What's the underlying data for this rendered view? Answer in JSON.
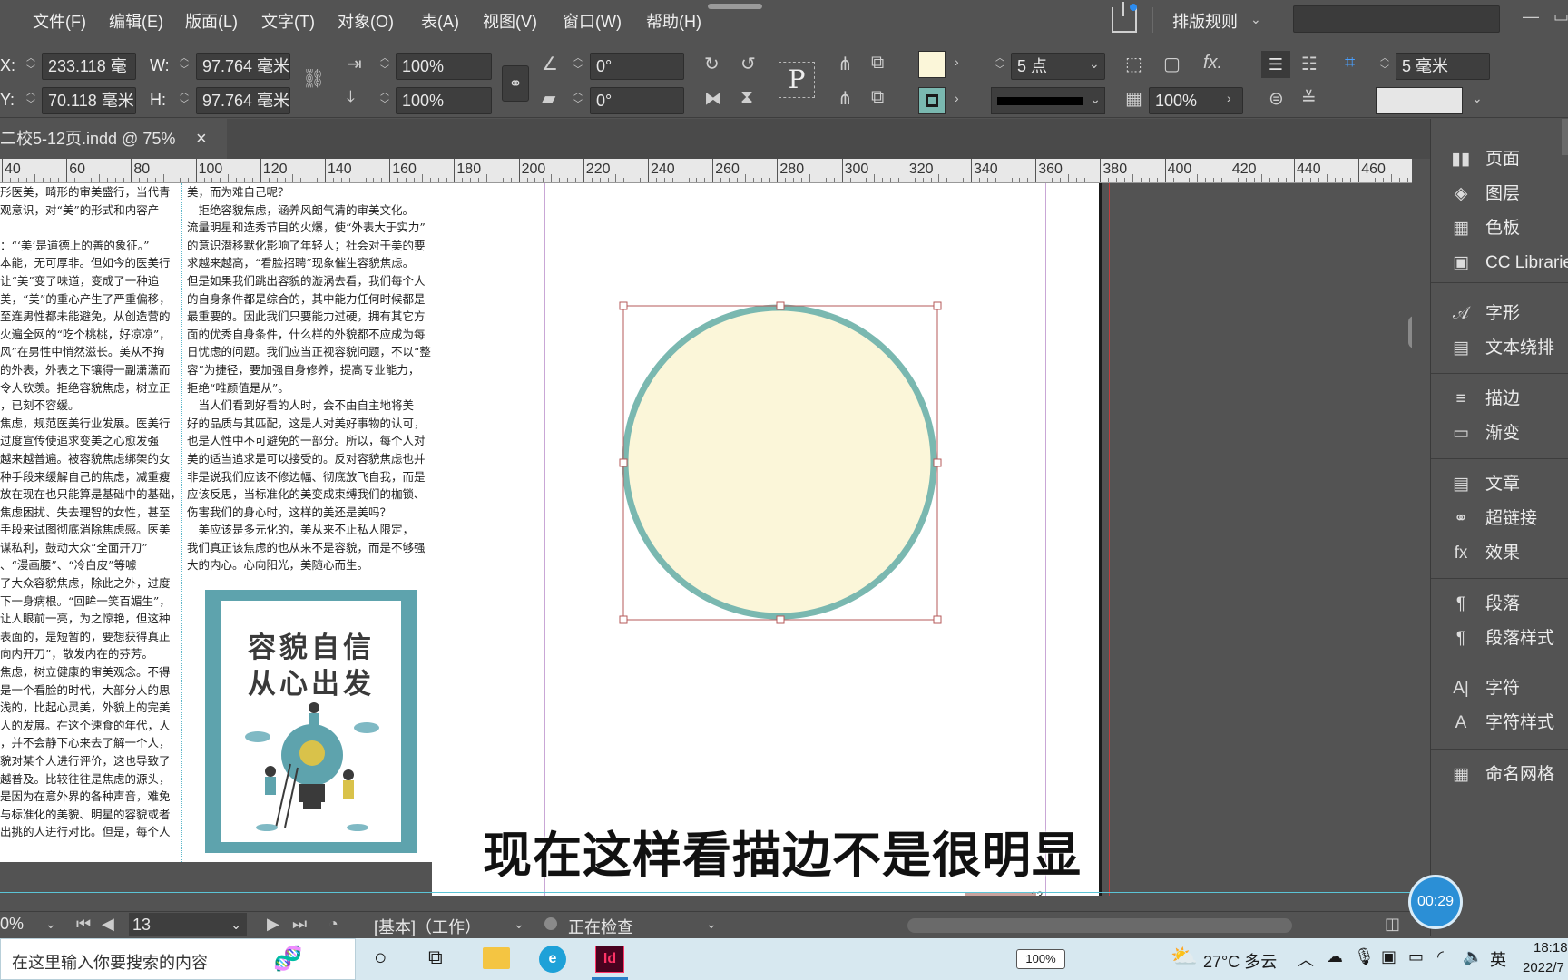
{
  "menu": {
    "items": [
      "文件(F)",
      "编辑(E)",
      "版面(L)",
      "文字(T)",
      "对象(O)",
      "表(A)",
      "视图(V)",
      "窗口(W)",
      "帮助(H)"
    ],
    "workspace": "排版规则"
  },
  "control": {
    "x_label": "X:",
    "x_value": "233.118 毫",
    "y_label": "Y:",
    "y_value": "70.118 毫米",
    "w_label": "W:",
    "w_value": "97.764 毫米",
    "h_label": "H:",
    "h_value": "97.764 毫米",
    "scale_x": "100%",
    "scale_y": "100%",
    "rotate": "0°",
    "shear": "0°",
    "stroke_weight": "5 点",
    "opacity": "100%",
    "corner": "5 毫米",
    "fill_color": "#fbf6d9",
    "stroke_color": "#7ab8b0"
  },
  "document": {
    "tab_title": "二校5-12页.indd @ 75%",
    "close": "×"
  },
  "ruler": {
    "labels": [
      "40",
      "60",
      "80",
      "100",
      "120",
      "140",
      "160",
      "180",
      "200",
      "220",
      "240",
      "260",
      "280",
      "300",
      "320",
      "340",
      "360",
      "380",
      "400",
      "420",
      "440",
      "460"
    ]
  },
  "page_text": {
    "col1": "形医美，畸形的审美盛行，当代青\n观意识，对“美”的形式和内容产\n\n：“‘美’是道德上的善的象征。”\n本能，无可厚非。但如今的医美行\n让“美”变了味道，变成了一种追\n美，“美”的重心产生了严重偏移，\n至连男性都未能避免，从创造营的\n火遍全网的“吃个桃桃，好凉凉”，\n风”在男性中悄然滋长。美从不拘\n的外表，外表之下镶得一副潇潇而\n令人钦羡。拒绝容貌焦虑，树立正\n，已刻不容缓。\n焦虑，规范医美行业发展。医美行\n过度宣传使追求变美之心愈发强\n越来越普遍。被容貌焦虑绑架的女\n种手段来缓解自己的焦虑，减重瘦\n放在现在也只能算是基础中的基础，\n焦虑困扰、失去理智的女性，甚至\n手段来试图彻底消除焦虑感。医美\n谋私利，鼓动大众“全面开刀”\n、“漫画腰”、“冷白皮”等噱\n了大众容貌焦虑，除此之外，过度\n下一身病根。“回眸一笑百媚生”，\n让人眼前一亮，为之惊艳，但这种\n表面的，是短暂的，要想获得真正\n向内开刀”，散发内在的芬芳。\n焦虑，树立健康的审美观念。不得\n是一个看脸的时代，大部分人的思\n浅的，比起心灵美，外貌上的完美\n人的发展。在这个速食的年代，人\n，并不会静下心来去了解一个人，\n貌对某个人进行评价，这也导致了\n越普及。比较往往是焦虑的源头，\n是因为在意外界的各种声音，难免\n与标准化的美貌、明星的容貌或者\n出挑的人进行对比。但是，每个人",
    "col2": "美，而为难自己呢？\n　拒绝容貌焦虑，涵养风朗气清的审美文化。\n流量明星和选秀节目的火爆，使“外表大于实力”\n的意识潜移默化影响了年轻人；社会对于美的要\n求越来越高，“看脸招聘”现象催生容貌焦虑。\n但是如果我们跳出容貌的漩涡去看，我们每个人\n的自身条件都是综合的，其中能力任何时候都是\n最重要的。因此我们只要能力过硬，拥有其它方\n面的优秀自身条件，什么样的外貌都不应成为每\n日忧虑的问题。我们应当正视容貌问题，不以“整\n容”为捷径，要加强自身修养，提高专业能力，\n拒绝“唯颜值是从”。\n　当人们看到好看的人时，会不由自主地将美\n好的品质与其匹配，这是人对美好事物的认可，\n也是人性中不可避免的一部分。所以，每个人对\n美的适当追求是可以接受的。反对容貌焦虑也并\n非是说我们应该不修边幅、彻底放飞自我，而是\n应该反思，当标准化的美变成束缚我们的枷锁、\n伤害我们的身心时，这样的美还是美吗？\n　美应该是多元化的，美从来不止私人限定，\n我们真正该焦虑的也从来不是容貌，而是不够强\n大的内心。心向阳光，美随心而生。",
    "poster_line1": "容貌自信",
    "poster_line2": "从心出发"
  },
  "panels": {
    "items": [
      {
        "icon": "pages-icon",
        "label": "页面"
      },
      {
        "icon": "layers-icon",
        "label": "图层"
      },
      {
        "icon": "swatches-icon",
        "label": "色板"
      },
      {
        "icon": "cc-libraries-icon",
        "label": "CC Libraries"
      },
      {
        "icon": "glyphs-icon",
        "label": "字形"
      },
      {
        "icon": "text-wrap-icon",
        "label": "文本绕排"
      },
      {
        "icon": "stroke-icon",
        "label": "描边"
      },
      {
        "icon": "gradient-icon",
        "label": "渐变"
      },
      {
        "icon": "articles-icon",
        "label": "文章"
      },
      {
        "icon": "hyperlinks-icon",
        "label": "超链接"
      },
      {
        "icon": "effects-icon",
        "label": "效果"
      },
      {
        "icon": "paragraph-icon",
        "label": "段落"
      },
      {
        "icon": "paragraph-styles-icon",
        "label": "段落样式"
      },
      {
        "icon": "character-icon",
        "label": "字符"
      },
      {
        "icon": "character-styles-icon",
        "label": "字符样式"
      },
      {
        "icon": "named-grids-icon",
        "label": "命名网格"
      }
    ]
  },
  "status": {
    "zoom": "0%",
    "page": "13",
    "mode": "[基本]（工作）",
    "preflight": "正在检查",
    "page_marker": "13",
    "timer": "00:29"
  },
  "caption": "现在这样看描边不是很明显",
  "taskbar": {
    "search_placeholder": "在这里输入你要搜索的内容",
    "battery": "100%",
    "weather": "27°C  多云",
    "ime": "英",
    "time": "18:18",
    "date": "2022/7"
  }
}
